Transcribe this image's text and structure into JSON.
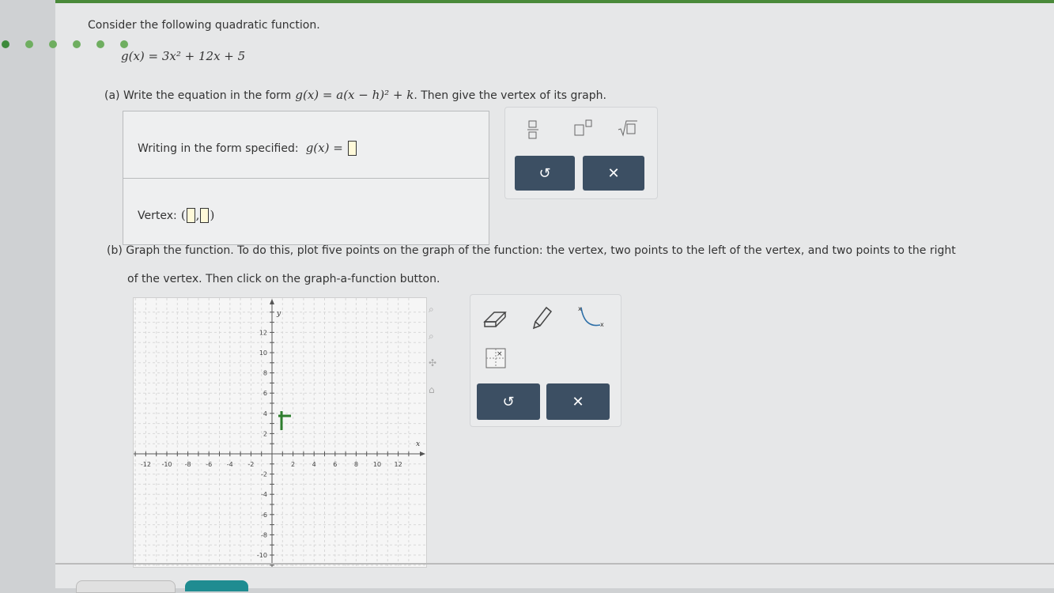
{
  "problem": {
    "intro": "Consider the following quadratic function.",
    "function_display": "g(x) = 3x² + 12x + 5",
    "part_a": {
      "prompt_before": "(a) Write the equation in the form",
      "form_display": "g(x) = a(x − h)² + k",
      "prompt_after": ". Then give the vertex of its graph.",
      "row1_label": "Writing in the form specified:",
      "row1_math": "g(x) =",
      "row2_label": "Vertex:"
    },
    "part_b": {
      "line1": "(b) Graph the function. To do this, plot five points on the graph of the function: the vertex, two points to the left of the vertex, and two points to the right",
      "line2": "of the vertex. Then click on the graph-a-function button."
    }
  },
  "math_toolbar": {
    "fraction_icon": "fraction-icon",
    "exponent_icon": "exponent-icon",
    "sqrt_icon": "sqrt-icon",
    "undo_icon": "undo-icon",
    "clear_icon": "clear-icon"
  },
  "graph_toolbar": {
    "eraser_icon": "eraser-icon",
    "pencil_icon": "pencil-icon",
    "parabola_icon": "parabola-icon",
    "graph_function_icon": "graph-function-icon",
    "undo_icon": "undo-icon",
    "clear_icon": "clear-icon"
  },
  "graph": {
    "x_axis_label": "x",
    "y_axis_label": "y",
    "x_ticks": [
      "-12",
      "-10",
      "-8",
      "-6",
      "-4",
      "-2",
      "2",
      "4",
      "6",
      "8",
      "10",
      "12"
    ],
    "y_ticks_pos": [
      "2",
      "4",
      "6",
      "8",
      "10",
      "12"
    ],
    "y_ticks_neg": [
      "-2",
      "-4",
      "-6",
      "-8",
      "-10"
    ]
  },
  "colors": {
    "button_dark": "#3c4f63",
    "accent_green": "#4a8a3a",
    "input_fill": "#fff9d9"
  }
}
